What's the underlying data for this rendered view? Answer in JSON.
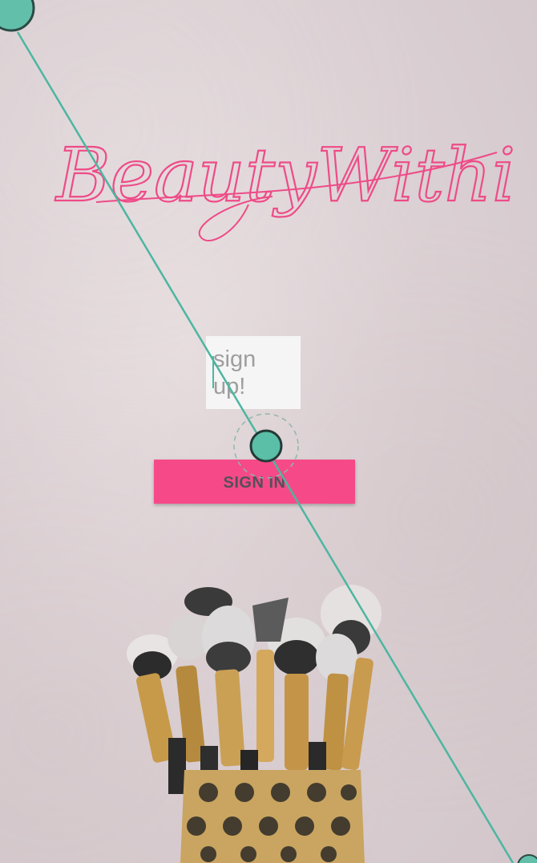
{
  "app": {
    "logo_text": "BeautyWithin"
  },
  "form": {
    "signup_placeholder": "sign up!",
    "signin_label": "SIGN IN"
  },
  "colors": {
    "accent": "#f64a88",
    "logo": "#ee4b87",
    "touch_indicator": "#4db6a0"
  },
  "decor": {
    "background": "makeup-brushes-photo",
    "overlay": "touch-gesture-indicator"
  }
}
